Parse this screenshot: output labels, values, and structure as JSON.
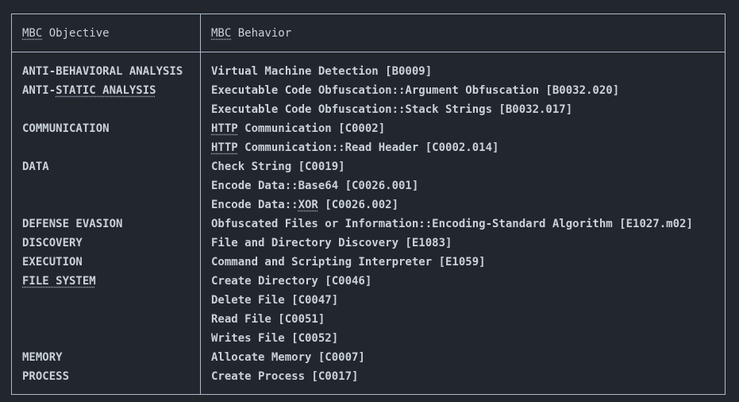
{
  "header": {
    "objective": "MBC Objective",
    "behavior": "MBC Behavior"
  },
  "rows": [
    {
      "objective": "ANTI-BEHAVIORAL ANALYSIS",
      "behavior": "Virtual Machine Detection [B0009]"
    },
    {
      "objective": "ANTI-STATIC ANALYSIS",
      "behavior": "Executable Code Obfuscation::Argument Obfuscation [B0032.020]"
    },
    {
      "objective": "",
      "behavior": "Executable Code Obfuscation::Stack Strings [B0032.017]"
    },
    {
      "objective": "COMMUNICATION",
      "behavior": "HTTP Communication [C0002]"
    },
    {
      "objective": "",
      "behavior": "HTTP Communication::Read Header [C0002.014]"
    },
    {
      "objective": "DATA",
      "behavior": "Check String [C0019]"
    },
    {
      "objective": "",
      "behavior": "Encode Data::Base64 [C0026.001]"
    },
    {
      "objective": "",
      "behavior": "Encode Data::XOR [C0026.002]"
    },
    {
      "objective": "DEFENSE EVASION",
      "behavior": "Obfuscated Files or Information::Encoding-Standard Algorithm [E1027.m02]"
    },
    {
      "objective": "DISCOVERY",
      "behavior": "File and Directory Discovery [E1083]"
    },
    {
      "objective": "EXECUTION",
      "behavior": "Command and Scripting Interpreter [E1059]"
    },
    {
      "objective": "FILE SYSTEM",
      "behavior": "Create Directory [C0046]"
    },
    {
      "objective": "",
      "behavior": "Delete File [C0047]"
    },
    {
      "objective": "",
      "behavior": "Read File [C0051]"
    },
    {
      "objective": "",
      "behavior": "Writes File [C0052]"
    },
    {
      "objective": "MEMORY",
      "behavior": "Allocate Memory [C0007]"
    },
    {
      "objective": "PROCESS",
      "behavior": "Create Process [C0017]"
    }
  ]
}
